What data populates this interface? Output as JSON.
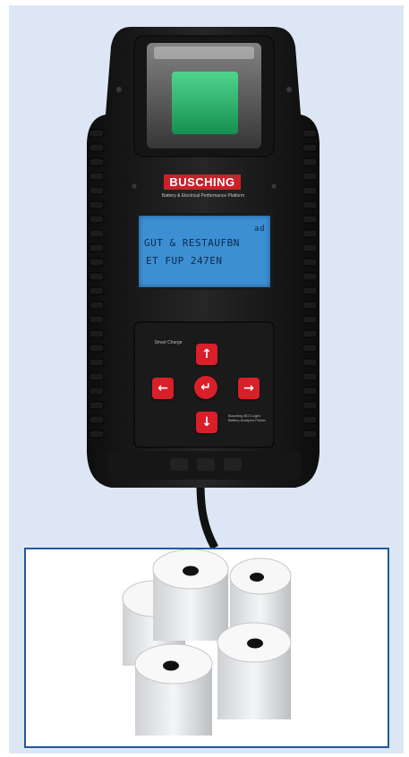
{
  "device": {
    "brand": "BUSCHING",
    "tagline": "Battery & Electrical Performance Platform",
    "lcd": {
      "line0": "ad",
      "line1": "GUT & RESTAUFBN",
      "line2": "ET FUP 247EN"
    },
    "keypad": {
      "up_icon": "arrow-up-icon",
      "down_icon": "arrow-down-icon",
      "left_icon": "arrow-left-icon",
      "right_icon": "arrow-right-icon",
      "enter_icon": "enter-icon"
    },
    "small_logo_text": "Smart Charge",
    "small_print": "Busching BCS Light Battery Analyzer Printer"
  },
  "colors": {
    "frame_background": "#dde6f4",
    "border_accent": "#1f5a9c",
    "brand_red": "#c8222b",
    "key_red": "#d81f2a",
    "lcd_blue": "#3d8fd3",
    "paper_window_green": "#2bb66a"
  }
}
